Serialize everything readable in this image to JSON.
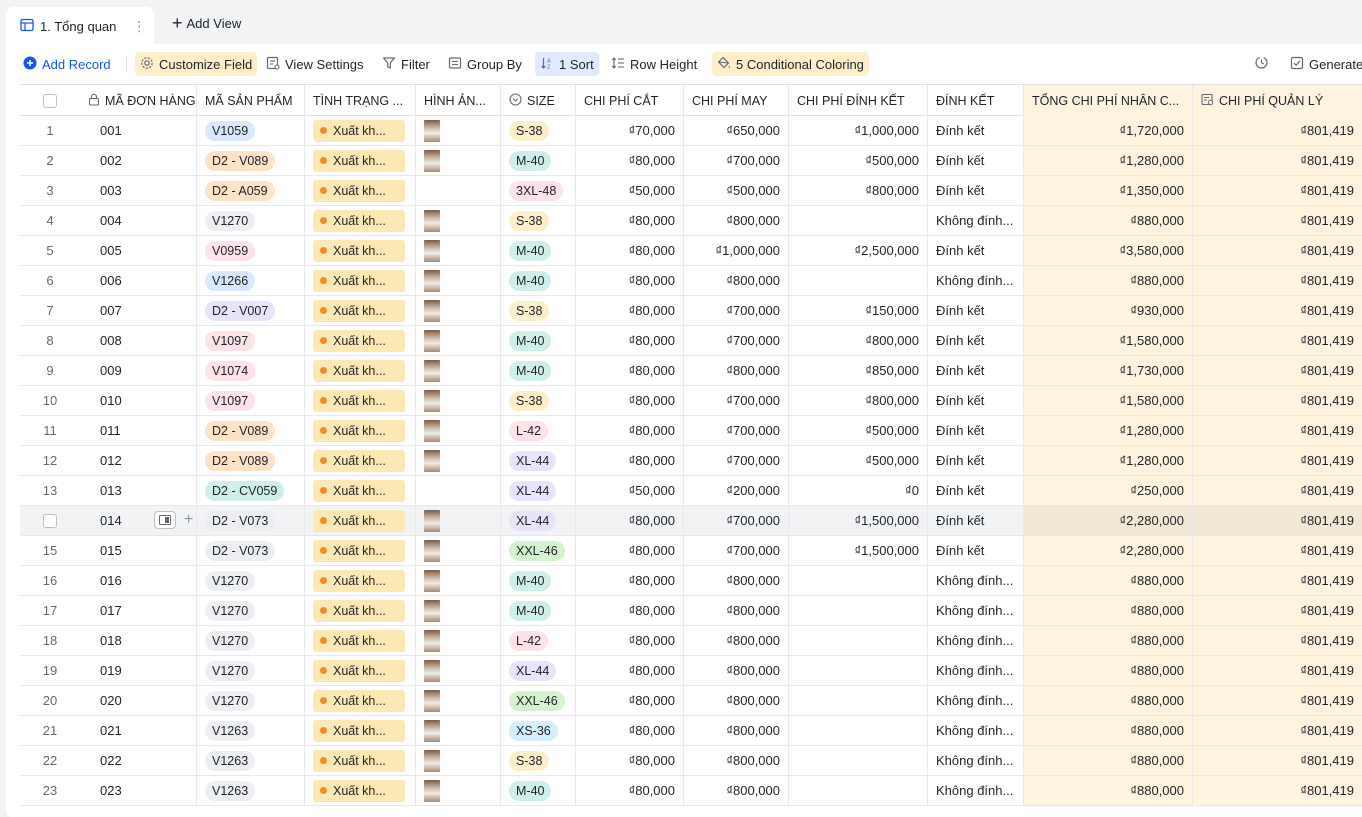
{
  "tabs": {
    "active_label": "1. Tổng quan",
    "add_view_label": "Add View"
  },
  "toolbar": {
    "add_record": "Add Record",
    "customize_field": "Customize Field",
    "view_settings": "View Settings",
    "filter": "Filter",
    "group_by": "Group By",
    "sort": "1 Sort",
    "row_height": "Row Height",
    "conditional_coloring": "5 Conditional Coloring",
    "generate": "Generate"
  },
  "columns": {
    "order_code": "MÃ ĐƠN HÀNG",
    "product_code": "MÃ SẢN PHẨM",
    "status": "TÌNH TRẠNG ...",
    "image": "HÌNH ẢN...",
    "size": "SIZE",
    "cut_cost": "CHI PHÍ CẮT",
    "sew_cost": "CHI PHÍ MAY",
    "bead_cost": "CHI PHÍ ĐÍNH KẾT",
    "bead": "ĐÍNH KẾT",
    "total_labor": "TỔNG CHI PHÍ NHÂN C...",
    "management": "CHI PHÍ QUẢN LÝ"
  },
  "colors": {
    "accent": "#1456f0",
    "highlight_column": "#fdf3de",
    "status_bg": "#fbe8b5",
    "status_dot": "#f28c28"
  },
  "rows": [
    {
      "n": "1",
      "code": "001",
      "product": "V1059",
      "product_color": "blue",
      "status": "Xuất kh...",
      "has_image": true,
      "size": "S-38",
      "size_color": "yellow",
      "cut": "₫70,000",
      "sew": "₫650,000",
      "bead_cost": "₫1,000,000",
      "bead": "Đính kết",
      "total": "₫1,720,000",
      "mgmt": "₫801,419"
    },
    {
      "n": "2",
      "code": "002",
      "product": "D2 - V089",
      "product_color": "orange",
      "status": "Xuất kh...",
      "has_image": true,
      "size": "M-40",
      "size_color": "teal",
      "cut": "₫80,000",
      "sew": "₫700,000",
      "bead_cost": "₫500,000",
      "bead": "Đính kết",
      "total": "₫1,280,000",
      "mgmt": "₫801,419"
    },
    {
      "n": "3",
      "code": "003",
      "product": "D2 - A059",
      "product_color": "orange",
      "status": "Xuất kh...",
      "has_image": false,
      "size": "3XL-48",
      "size_color": "pink",
      "cut": "₫50,000",
      "sew": "₫500,000",
      "bead_cost": "₫800,000",
      "bead": "Đính kết",
      "total": "₫1,350,000",
      "mgmt": "₫801,419"
    },
    {
      "n": "4",
      "code": "004",
      "product": "V1270",
      "product_color": "gray",
      "status": "Xuất kh...",
      "has_image": true,
      "size": "S-38",
      "size_color": "yellow",
      "cut": "₫80,000",
      "sew": "₫800,000",
      "bead_cost": "",
      "bead": "Không đính...",
      "total": "₫880,000",
      "mgmt": "₫801,419"
    },
    {
      "n": "5",
      "code": "005",
      "product": "V0959",
      "product_color": "pink",
      "status": "Xuất kh...",
      "has_image": true,
      "size": "M-40",
      "size_color": "teal",
      "cut": "₫80,000",
      "sew": "₫1,000,000",
      "bead_cost": "₫2,500,000",
      "bead": "Đính kết",
      "total": "₫3,580,000",
      "mgmt": "₫801,419"
    },
    {
      "n": "6",
      "code": "006",
      "product": "V1266",
      "product_color": "blue",
      "status": "Xuất kh...",
      "has_image": true,
      "size": "M-40",
      "size_color": "teal",
      "cut": "₫80,000",
      "sew": "₫800,000",
      "bead_cost": "",
      "bead": "Không đính...",
      "total": "₫880,000",
      "mgmt": "₫801,419"
    },
    {
      "n": "7",
      "code": "007",
      "product": "D2 - V007",
      "product_color": "purple",
      "status": "Xuất kh...",
      "has_image": true,
      "size": "S-38",
      "size_color": "yellow",
      "cut": "₫80,000",
      "sew": "₫700,000",
      "bead_cost": "₫150,000",
      "bead": "Đính kết",
      "total": "₫930,000",
      "mgmt": "₫801,419"
    },
    {
      "n": "8",
      "code": "008",
      "product": "V1097",
      "product_color": "pink",
      "status": "Xuất kh...",
      "has_image": true,
      "size": "M-40",
      "size_color": "teal",
      "cut": "₫80,000",
      "sew": "₫700,000",
      "bead_cost": "₫800,000",
      "bead": "Đính kết",
      "total": "₫1,580,000",
      "mgmt": "₫801,419"
    },
    {
      "n": "9",
      "code": "009",
      "product": "V1074",
      "product_color": "pink",
      "status": "Xuất kh...",
      "has_image": true,
      "size": "M-40",
      "size_color": "teal",
      "cut": "₫80,000",
      "sew": "₫800,000",
      "bead_cost": "₫850,000",
      "bead": "Đính kết",
      "total": "₫1,730,000",
      "mgmt": "₫801,419"
    },
    {
      "n": "10",
      "code": "010",
      "product": "V1097",
      "product_color": "pink",
      "status": "Xuất kh...",
      "has_image": true,
      "size": "S-38",
      "size_color": "yellow",
      "cut": "₫80,000",
      "sew": "₫700,000",
      "bead_cost": "₫800,000",
      "bead": "Đính kết",
      "total": "₫1,580,000",
      "mgmt": "₫801,419"
    },
    {
      "n": "11",
      "code": "011",
      "product": "D2 - V089",
      "product_color": "orange",
      "status": "Xuất kh...",
      "has_image": true,
      "size": "L-42",
      "size_color": "pink",
      "cut": "₫80,000",
      "sew": "₫700,000",
      "bead_cost": "₫500,000",
      "bead": "Đính kết",
      "total": "₫1,280,000",
      "mgmt": "₫801,419"
    },
    {
      "n": "12",
      "code": "012",
      "product": "D2 - V089",
      "product_color": "orange",
      "status": "Xuất kh...",
      "has_image": true,
      "size": "XL-44",
      "size_color": "purple",
      "cut": "₫80,000",
      "sew": "₫700,000",
      "bead_cost": "₫500,000",
      "bead": "Đính kết",
      "total": "₫1,280,000",
      "mgmt": "₫801,419"
    },
    {
      "n": "13",
      "code": "013",
      "product": "D2 - CV059",
      "product_color": "teal",
      "status": "Xuất kh...",
      "has_image": false,
      "size": "XL-44",
      "size_color": "purple",
      "cut": "₫50,000",
      "sew": "₫200,000",
      "bead_cost": "₫0",
      "bead": "Đính kết",
      "total": "₫250,000",
      "mgmt": "₫801,419"
    },
    {
      "n": "",
      "code": "014",
      "product": "D2 - V073",
      "product_color": "gray",
      "status": "Xuất kh...",
      "has_image": true,
      "size": "XL-44",
      "size_color": "purple",
      "cut": "₫80,000",
      "sew": "₫700,000",
      "bead_cost": "₫1,500,000",
      "bead": "Đính kết",
      "total": "₫2,280,000",
      "mgmt": "₫801,419",
      "hover": true
    },
    {
      "n": "15",
      "code": "015",
      "product": "D2 - V073",
      "product_color": "gray",
      "status": "Xuất kh...",
      "has_image": true,
      "size": "XXL-46",
      "size_color": "green",
      "cut": "₫80,000",
      "sew": "₫700,000",
      "bead_cost": "₫1,500,000",
      "bead": "Đính kết",
      "total": "₫2,280,000",
      "mgmt": "₫801,419"
    },
    {
      "n": "16",
      "code": "016",
      "product": "V1270",
      "product_color": "gray",
      "status": "Xuất kh...",
      "has_image": true,
      "size": "M-40",
      "size_color": "teal",
      "cut": "₫80,000",
      "sew": "₫800,000",
      "bead_cost": "",
      "bead": "Không đính...",
      "total": "₫880,000",
      "mgmt": "₫801,419"
    },
    {
      "n": "17",
      "code": "017",
      "product": "V1270",
      "product_color": "gray",
      "status": "Xuất kh...",
      "has_image": true,
      "size": "M-40",
      "size_color": "teal",
      "cut": "₫80,000",
      "sew": "₫800,000",
      "bead_cost": "",
      "bead": "Không đính...",
      "total": "₫880,000",
      "mgmt": "₫801,419"
    },
    {
      "n": "18",
      "code": "018",
      "product": "V1270",
      "product_color": "gray",
      "status": "Xuất kh...",
      "has_image": true,
      "size": "L-42",
      "size_color": "pink",
      "cut": "₫80,000",
      "sew": "₫800,000",
      "bead_cost": "",
      "bead": "Không đính...",
      "total": "₫880,000",
      "mgmt": "₫801,419"
    },
    {
      "n": "19",
      "code": "019",
      "product": "V1270",
      "product_color": "gray",
      "status": "Xuất kh...",
      "has_image": true,
      "size": "XL-44",
      "size_color": "purple",
      "cut": "₫80,000",
      "sew": "₫800,000",
      "bead_cost": "",
      "bead": "Không đính...",
      "total": "₫880,000",
      "mgmt": "₫801,419"
    },
    {
      "n": "20",
      "code": "020",
      "product": "V1270",
      "product_color": "gray",
      "status": "Xuất kh...",
      "has_image": true,
      "size": "XXL-46",
      "size_color": "green",
      "cut": "₫80,000",
      "sew": "₫800,000",
      "bead_cost": "",
      "bead": "Không đính...",
      "total": "₫880,000",
      "mgmt": "₫801,419"
    },
    {
      "n": "21",
      "code": "021",
      "product": "V1263",
      "product_color": "gray",
      "status": "Xuất kh...",
      "has_image": true,
      "size": "XS-36",
      "size_color": "lblue",
      "cut": "₫80,000",
      "sew": "₫800,000",
      "bead_cost": "",
      "bead": "Không đính...",
      "total": "₫880,000",
      "mgmt": "₫801,419"
    },
    {
      "n": "22",
      "code": "022",
      "product": "V1263",
      "product_color": "gray",
      "status": "Xuất kh...",
      "has_image": true,
      "size": "S-38",
      "size_color": "yellow",
      "cut": "₫80,000",
      "sew": "₫800,000",
      "bead_cost": "",
      "bead": "Không đính...",
      "total": "₫880,000",
      "mgmt": "₫801,419"
    },
    {
      "n": "23",
      "code": "023",
      "product": "V1263",
      "product_color": "gray",
      "status": "Xuất kh...",
      "has_image": true,
      "size": "M-40",
      "size_color": "teal",
      "cut": "₫80,000",
      "sew": "₫800,000",
      "bead_cost": "",
      "bead": "Không đính...",
      "total": "₫880,000",
      "mgmt": "₫801,419"
    }
  ]
}
